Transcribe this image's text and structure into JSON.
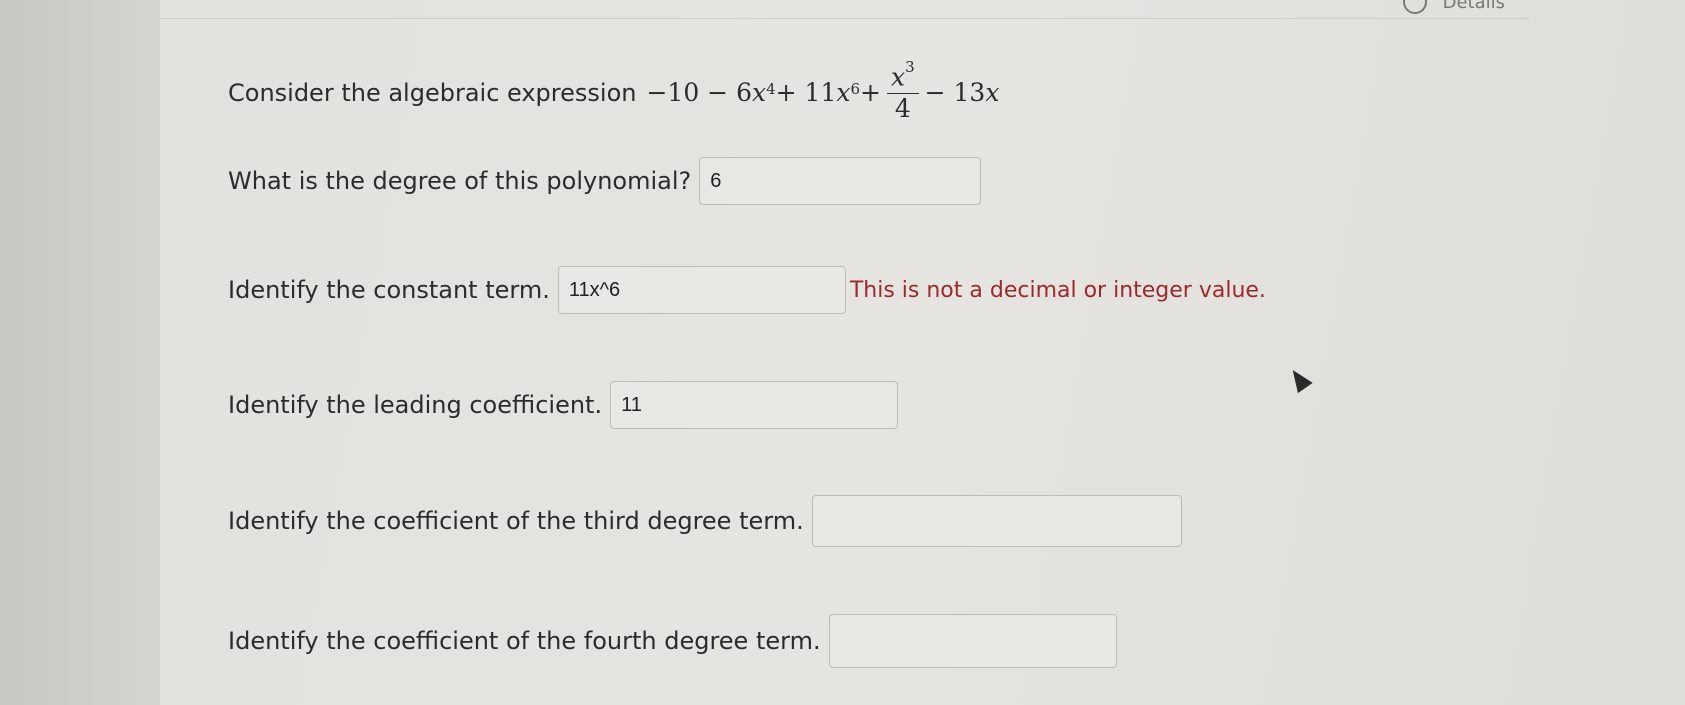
{
  "topbar": {
    "details_label": "Details"
  },
  "question": {
    "intro": "Consider the algebraic expression",
    "expression": {
      "t1": "−10 − 6",
      "x4": "x",
      "e4": "4",
      "t2": " + 11",
      "x6": "x",
      "e6": "6",
      "t3": " +",
      "frac_num_x": "x",
      "frac_num_e": "3",
      "frac_den": "4",
      "t4": "− 13",
      "x1": "x"
    }
  },
  "items": [
    {
      "prompt": "What is the degree of this polynomial?",
      "value": "6",
      "error": ""
    },
    {
      "prompt": "Identify the constant term.",
      "value": "11x^6",
      "error": "This is not a decimal or integer value."
    },
    {
      "prompt": "Identify the leading coefficient.",
      "value": "11",
      "error": ""
    },
    {
      "prompt": "Identify the coefficient of the third degree term.",
      "value": "",
      "error": ""
    },
    {
      "prompt": "Identify the coefficient of the fourth degree term.",
      "value": "",
      "error": ""
    }
  ]
}
